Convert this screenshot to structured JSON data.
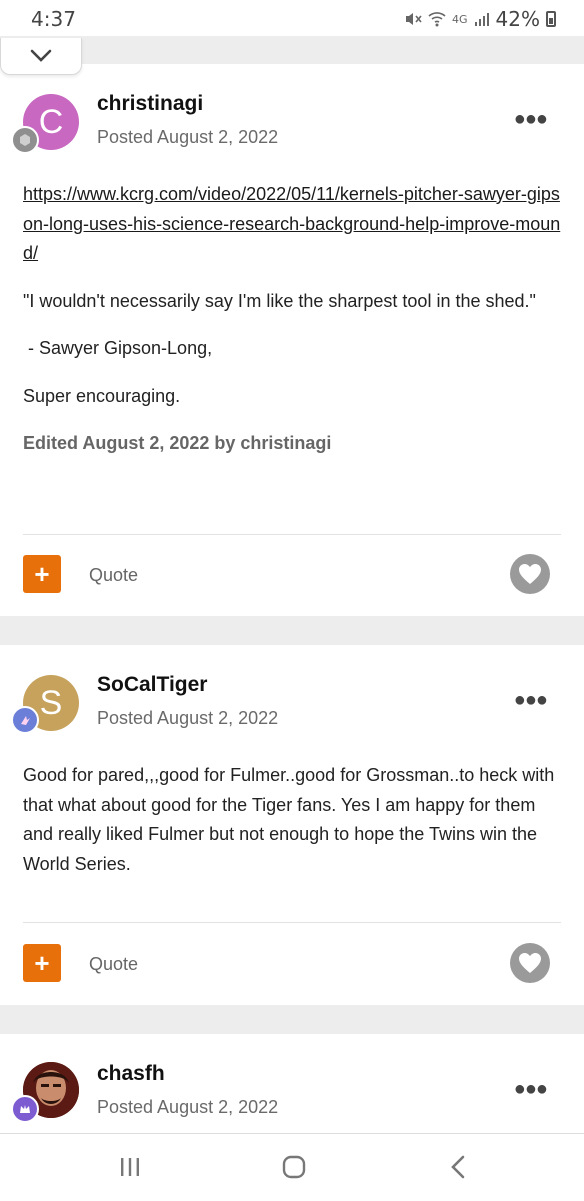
{
  "status": {
    "time": "4:37",
    "network": "4G",
    "battery": "42%"
  },
  "collapse": {
    "icon": "chevron-down-icon"
  },
  "posts": [
    {
      "author": "christinagi",
      "avatar_letter": "C",
      "avatar_color": "#c868c0",
      "posted": "Posted August 2, 2022",
      "link": "https://www.kcrg.com/video/2022/05/11/kernels-pitcher-sawyer-gipson-long-uses-his-science-research-background-help-improve-mound/",
      "paragraphs": [
        "\"I wouldn't necessarily say I'm like the sharpest tool in the shed.\"",
        " - Sawyer Gipson-Long,",
        "Super encouraging."
      ],
      "edited": "Edited August 2, 2022 by christinagi",
      "quote_label": "Quote"
    },
    {
      "author": "SoCalTiger",
      "avatar_letter": "S",
      "avatar_color": "#c6a25c",
      "posted": "Posted August 2, 2022",
      "body": "Good for pared,,,good for Fulmer..good for Grossman..to heck with that what about good for the Tiger fans. Yes I am happy for them and really liked Fulmer but not enough to hope the Twins win the World Series.",
      "quote_label": "Quote"
    },
    {
      "author": "chasfh",
      "posted": "Posted August 2, 2022"
    }
  ],
  "colors": {
    "accent": "#e8700a",
    "like": "#9a9a9a"
  }
}
